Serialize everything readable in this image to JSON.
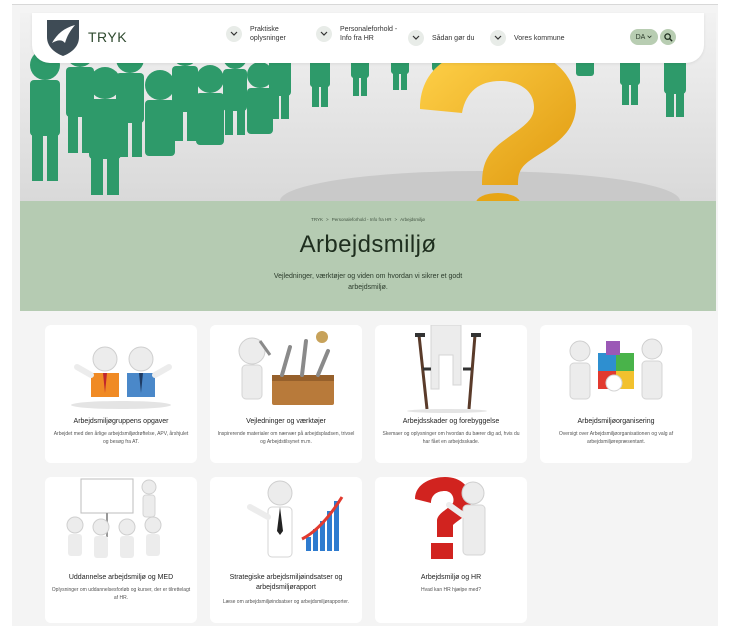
{
  "header": {
    "brand": "TRYK",
    "nav": [
      {
        "label": "Praktiske oplysninger"
      },
      {
        "label": "Personaleforhold - Info fra HR"
      },
      {
        "label": "Sådan gør du"
      },
      {
        "label": "Vores kommune"
      }
    ],
    "language": "DA"
  },
  "banner": {
    "breadcrumb": [
      "TRYK",
      "Personaleforhold - Info fra HR",
      "Arbejdsmiljø"
    ],
    "title": "Arbejdsmiljø",
    "subtitle": "Vejledninger, værktøjer og viden om hvordan vi sikrer et godt arbejdsmiljø."
  },
  "cards": [
    {
      "title": "Arbejdsmiljøgruppens opgaver",
      "desc": "Arbejdet med den årlige arbejdsmiljødrøftelse, APV, årshjulet og besøg fra AT.",
      "icon": "two-figures-illustration"
    },
    {
      "title": "Vejledninger og værktøjer",
      "desc": "Inspirerende materialer om nærvær på arbejdspladsen, trivsel og Arbejdstilsynet m.m.",
      "icon": "toolbox-illustration"
    },
    {
      "title": "Arbejdsskader og forebyggelse",
      "desc": "Skemaer og oplysninger om hvordan du bærer dig ad, hvis du har fået en arbejdsskade.",
      "icon": "crutches-illustration"
    },
    {
      "title": "Arbejdsmiljøorganisering",
      "desc": "Oversigt over Arbejdsmiljøorganisationen og valg af arbejdsmiljørepræsentant.",
      "icon": "puzzle-illustration"
    },
    {
      "title": "Uddannelse arbejdsmiljø og MED",
      "desc": "Oplysninger om uddannelsesforløb og kurser, der er tilrettelagt af HR.",
      "icon": "presentation-illustration"
    },
    {
      "title": "Strategiske arbejdsmiljøindsatser og arbejdsmiljørapport",
      "desc": "Læse om arbejdsmiljøindsatser og arbejdsmiljørapporter.",
      "icon": "growth-chart-illustration"
    },
    {
      "title": "Arbejdsmiljø og HR",
      "desc": "Hvad kan HR hjælpe med?",
      "icon": "question-figure-illustration"
    }
  ],
  "colors": {
    "banner": "#b5cbb2",
    "accent": "#b8cdb2",
    "figures": "#2e9a6a",
    "question": "#f2b01e"
  }
}
